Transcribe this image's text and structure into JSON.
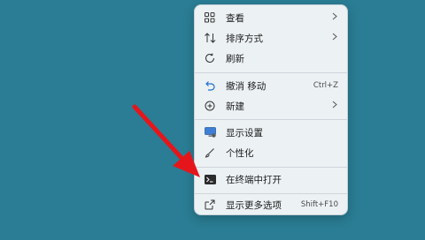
{
  "context_menu": {
    "items": [
      {
        "label": "查看",
        "icon": "grid-view-icon",
        "submenu": true
      },
      {
        "label": "排序方式",
        "icon": "sort-icon",
        "submenu": true
      },
      {
        "label": "刷新",
        "icon": "refresh-icon"
      },
      {
        "label": "撤消 移动",
        "icon": "undo-icon",
        "shortcut": "Ctrl+Z"
      },
      {
        "label": "新建",
        "icon": "new-plus-icon",
        "submenu": true
      },
      {
        "label": "显示设置",
        "icon": "display-settings-icon"
      },
      {
        "label": "个性化",
        "icon": "personalize-brush-icon"
      },
      {
        "label": "在终端中打开",
        "icon": "terminal-icon"
      },
      {
        "label": "显示更多选项",
        "icon": "more-options-icon",
        "shortcut": "Shift+F10"
      }
    ]
  },
  "colors": {
    "desktop": "#2a7d94",
    "menu_bg": "#ecf1f3",
    "accent": "#1f6fd1",
    "arrow": "#e5161b"
  }
}
